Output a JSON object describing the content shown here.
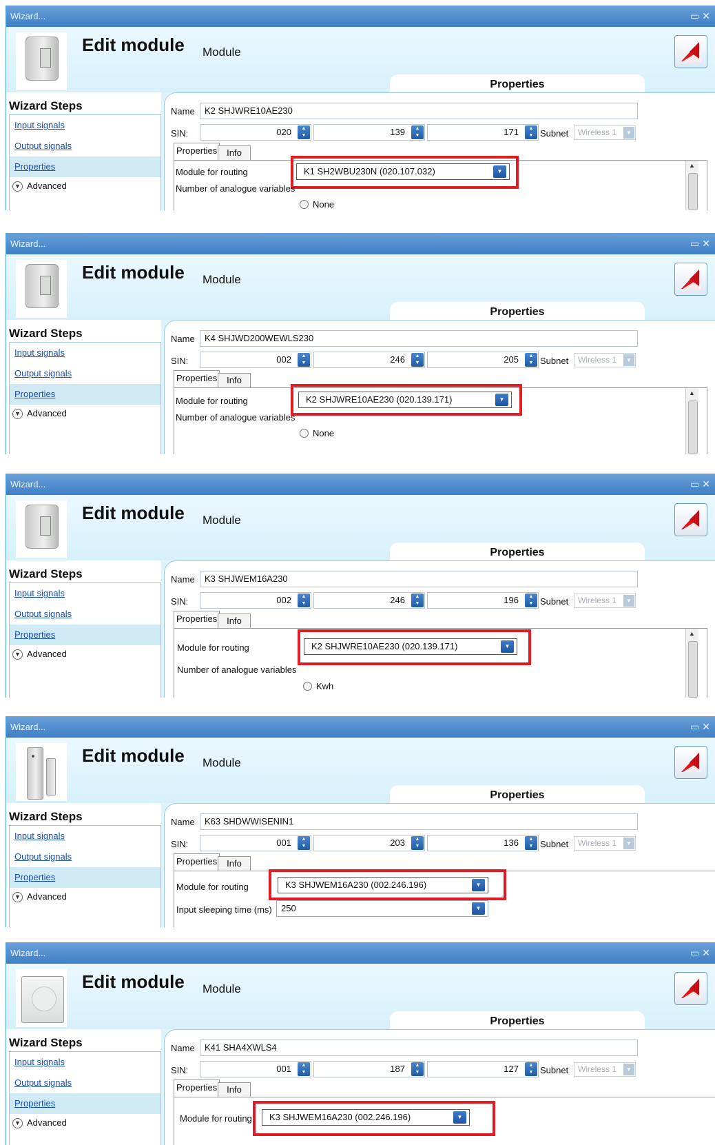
{
  "panels": [
    {
      "title": "Wizard...",
      "header": {
        "title": "Edit module",
        "subtitle": "Module",
        "tab": "Properties"
      },
      "sidebar": {
        "title": "Wizard Steps",
        "items": [
          "Input signals",
          "Output signals",
          "Properties"
        ],
        "advanced": "Advanced"
      },
      "name_label": "Name",
      "name_value": "K2 SHJWRE10AE230",
      "sin_label": "SIN:",
      "sin": [
        "020",
        "139",
        "171"
      ],
      "subnet_label": "Subnet",
      "subnet_value": "Wireless 1",
      "tabs": [
        "Properties",
        "Info"
      ],
      "routing_label": "Module for routing",
      "routing_value": "K1 SH2WBU230N (020.107.032)",
      "extra_label": "Number of analogue variables",
      "radio_label": "None"
    },
    {
      "title": "Wizard...",
      "header": {
        "title": "Edit module",
        "subtitle": "Module",
        "tab": "Properties"
      },
      "sidebar": {
        "title": "Wizard Steps",
        "items": [
          "Input signals",
          "Output signals",
          "Properties"
        ],
        "advanced": "Advanced"
      },
      "name_label": "Name",
      "name_value": "K4 SHJWD200WEWLS230",
      "sin_label": "SIN:",
      "sin": [
        "002",
        "246",
        "205"
      ],
      "subnet_label": "Subnet",
      "subnet_value": "Wireless 1",
      "tabs": [
        "Properties",
        "Info"
      ],
      "routing_label": "Module for routing",
      "routing_value": "K2 SHJWRE10AE230 (020.139.171)",
      "extra_label": "Number of analogue variables",
      "radio_label": "None"
    },
    {
      "title": "Wizard...",
      "header": {
        "title": "Edit module",
        "subtitle": "Module",
        "tab": "Properties"
      },
      "sidebar": {
        "title": "Wizard Steps",
        "items": [
          "Input signals",
          "Output signals",
          "Properties"
        ],
        "advanced": "Advanced"
      },
      "name_label": "Name",
      "name_value": "K3 SHJWEM16A230",
      "sin_label": "SIN:",
      "sin": [
        "002",
        "246",
        "196"
      ],
      "subnet_label": "Subnet",
      "subnet_value": "Wireless 1",
      "tabs": [
        "Properties",
        "Info"
      ],
      "routing_label": "Module for routing",
      "routing_value": "K2 SHJWRE10AE230 (020.139.171)",
      "extra_label": "Number of analogue variables",
      "radio_label": "Kwh"
    },
    {
      "title": "Wizard...",
      "header": {
        "title": "Edit module",
        "subtitle": "Module",
        "tab": "Properties"
      },
      "sidebar": {
        "title": "Wizard Steps",
        "items": [
          "Input signals",
          "Output signals",
          "Properties"
        ],
        "advanced": "Advanced"
      },
      "name_label": "Name",
      "name_value": "K63 SHDWWISENIN1",
      "sin_label": "SIN:",
      "sin": [
        "001",
        "203",
        "136"
      ],
      "subnet_label": "Subnet",
      "subnet_value": "Wireless 1",
      "tabs": [
        "Properties",
        "Info"
      ],
      "routing_label": "Module for routing",
      "routing_value": "K3 SHJWEM16A230 (002.246.196)",
      "sleep_label": "Input sleeping time (ms)",
      "sleep_value": "250"
    },
    {
      "title": "Wizard...",
      "header": {
        "title": "Edit module",
        "subtitle": "Module",
        "tab": "Properties"
      },
      "sidebar": {
        "title": "Wizard Steps",
        "items": [
          "Input signals",
          "Output signals",
          "Properties"
        ],
        "advanced": "Advanced"
      },
      "name_label": "Name",
      "name_value": "K41 SHA4XWLS4",
      "sin_label": "SIN:",
      "sin": [
        "001",
        "187",
        "127"
      ],
      "subnet_label": "Subnet",
      "subnet_value": "Wireless 1",
      "tabs": [
        "Properties",
        "Info"
      ],
      "routing_label": "Module for routing",
      "routing_value": "K3 SHJWEM16A230 (002.246.196)"
    }
  ],
  "colors": {
    "highlight": "#e31b23",
    "titlebar": "#4a8bd0",
    "link": "#1a4fb4"
  }
}
